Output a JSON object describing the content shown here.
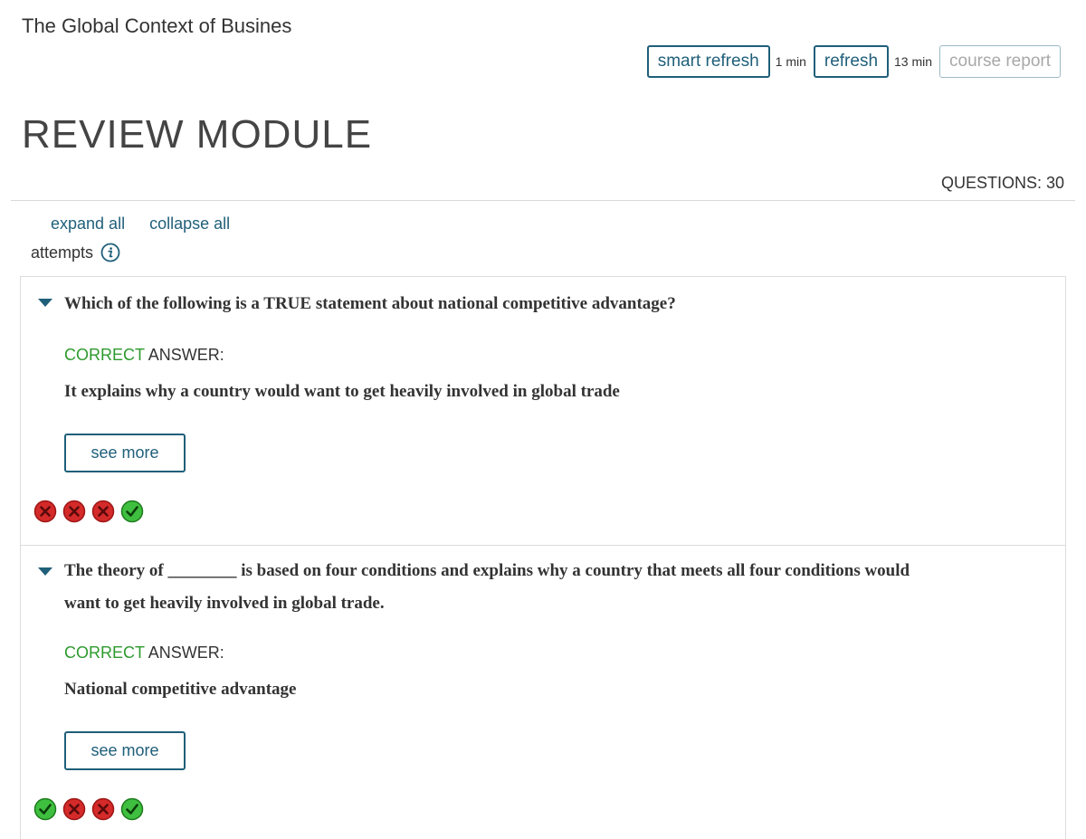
{
  "course_title": "The Global Context of Busines",
  "toolbar": {
    "smart_refresh_label": "smart refresh",
    "smart_refresh_time": "1 min",
    "refresh_label": "refresh",
    "refresh_time": "13 min",
    "course_report_label": "course report"
  },
  "module_title": "REVIEW MODULE",
  "questions_count": "QUESTIONS: 30",
  "controls": {
    "expand_all": "expand all",
    "collapse_all": "collapse all",
    "attempts_label": "attempts"
  },
  "questions": [
    {
      "text": "Which of the following is a TRUE statement about national competitive advantage?",
      "correct_word": "CORRECT",
      "answer_label": " ANSWER:",
      "answer": "It explains why a country would want to get heavily involved in global trade",
      "see_more": "see more",
      "attempts": [
        "incorrect",
        "incorrect",
        "incorrect",
        "correct"
      ]
    },
    {
      "text": "The theory of ________ is based on four conditions and explains why a country that meets all four conditions would want to get heavily involved in global trade.",
      "correct_word": "CORRECT",
      "answer_label": " ANSWER:",
      "answer": "National competitive advantage",
      "see_more": "see more",
      "attempts": [
        "correct",
        "incorrect",
        "incorrect",
        "correct"
      ]
    }
  ],
  "colors": {
    "accent": "#1f5f7a",
    "correct_green": "#2e9a2e",
    "incorrect_red": "#d42a2a"
  }
}
